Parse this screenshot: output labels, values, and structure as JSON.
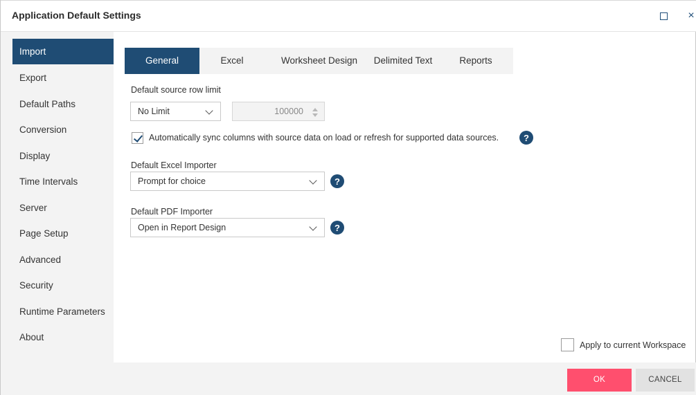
{
  "window": {
    "title": "Application Default Settings"
  },
  "sidebar": {
    "items": [
      {
        "label": "Import",
        "active": true
      },
      {
        "label": "Export"
      },
      {
        "label": "Default Paths"
      },
      {
        "label": "Conversion"
      },
      {
        "label": "Display"
      },
      {
        "label": "Time Intervals"
      },
      {
        "label": "Server"
      },
      {
        "label": "Page Setup"
      },
      {
        "label": "Advanced"
      },
      {
        "label": "Security"
      },
      {
        "label": "Runtime Parameters"
      },
      {
        "label": "About"
      }
    ]
  },
  "tabs": [
    {
      "label": "General",
      "active": true
    },
    {
      "label": "Excel"
    },
    {
      "label": "Worksheet Design"
    },
    {
      "label": "Delimited Text"
    },
    {
      "label": "Reports"
    }
  ],
  "general": {
    "row_limit_label": "Default source row limit",
    "row_limit_mode": "No Limit",
    "row_limit_value": "100000",
    "sync_checkbox_label": "Automatically sync columns with source data on load or refresh for supported data sources.",
    "sync_checked": true,
    "excel_importer_label": "Default Excel Importer",
    "excel_importer_value": "Prompt for choice",
    "pdf_importer_label": "Default PDF Importer",
    "pdf_importer_value": "Open in Report Design",
    "help_glyph": "?",
    "apply_workspace_label": "Apply to current Workspace",
    "apply_workspace_checked": false
  },
  "footer": {
    "ok_label": "OK",
    "cancel_label": "CANCEL"
  },
  "colors": {
    "accent": "#1f4c74",
    "ok_button": "#ff4f6e"
  },
  "icons": {
    "maximize": "square",
    "close": "×"
  }
}
